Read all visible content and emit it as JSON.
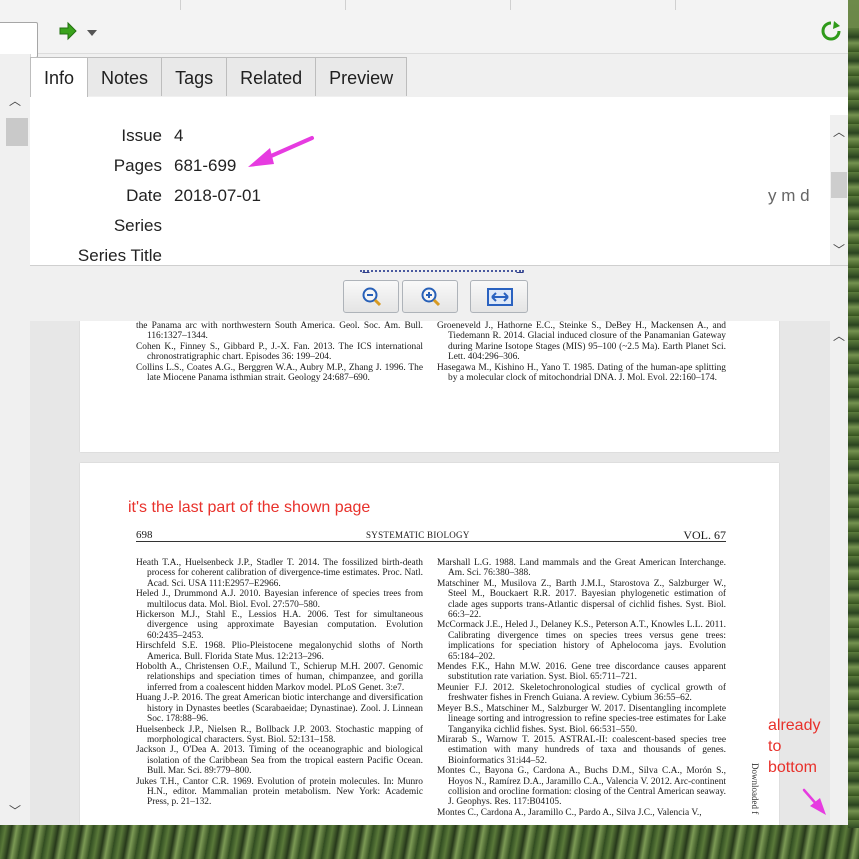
{
  "toolbar": {
    "forward_icon": "green-right-arrow-icon",
    "dropdown_icon": "chevron-down-icon",
    "sync_icon": "green-sync-icon"
  },
  "tabs": [
    "Info",
    "Notes",
    "Tags",
    "Related",
    "Preview"
  ],
  "info": {
    "fields": [
      {
        "label": "Issue",
        "value": "4"
      },
      {
        "label": "Pages",
        "value": "681-699"
      },
      {
        "label": "Date",
        "value": "2018-07-01"
      },
      {
        "label": "Series",
        "value": ""
      },
      {
        "label": "Series Title",
        "value": ""
      }
    ],
    "date_format": "y m d"
  },
  "pdf": {
    "page1": {
      "left_refs": [
        "the Panama arc with northwestern South America. Geol. Soc. Am. Bull. 116:1327–1344.",
        "Cohen K., Finney S., Gibbard P., J.-X. Fan. 2013. The ICS international chronostratigraphic chart. Episodes 36: 199–204.",
        "Collins L.S., Coates A.G., Berggren W.A., Aubry M.P., Zhang J. 1996. The late Miocene Panama isthmian strait. Geology 24:687–690."
      ],
      "right_refs": [
        "Groeneveld J., Hathorne E.C., Steinke S., DeBey H., Mackensen A., and Tiedemann R. 2014. Glacial induced closure of the Panamanian Gateway during Marine Isotope Stages (MIS) 95–100 (~2.5 Ma). Earth Planet Sci. Lett. 404:296–306.",
        "Hasegawa M., Kishino H., Yano T. 1985. Dating of the human-ape splitting by a molecular clock of mitochondrial DNA. J. Mol. Evol. 22:160–174."
      ]
    },
    "page2": {
      "page_number": "698",
      "journal": "SYSTEMATIC BIOLOGY",
      "volume": "VOL. 67",
      "side_text": "Downloaded f",
      "left_refs": [
        "Heath T.A., Huelsenbeck J.P., Stadler T. 2014. The fossilized birth-death process for coherent calibration of divergence-time estimates. Proc. Natl. Acad. Sci. USA 111:E2957–E2966.",
        "Heled J., Drummond A.J. 2010. Bayesian inference of species trees from multilocus data. Mol. Biol. Evol. 27:570–580.",
        "Hickerson M.J., Stahl E., Lessios H.A. 2006. Test for simultaneous divergence using approximate Bayesian computation. Evolution 60:2435–2453.",
        "Hirschfeld S.E. 1968. Plio-Pleistocene megalonychid sloths of North America. Bull. Florida State Mus. 12:213–296.",
        "Hobolth A., Christensen O.F., Mailund T., Schierup M.H. 2007. Genomic relationships and speciation times of human, chimpanzee, and gorilla inferred from a coalescent hidden Markov model. PLoS Genet. 3:e7.",
        "Huang J.-P. 2016. The great American biotic interchange and diversification history in Dynastes beetles (Scarabaeidae; Dynastinae). Zool. J. Linnean Soc. 178:88–96.",
        "Huelsenbeck J.P., Nielsen R., Bollback J.P. 2003. Stochastic mapping of morphological characters. Syst. Biol. 52:131–158.",
        "Jackson J., O'Dea A. 2013. Timing of the oceanographic and biological isolation of the Caribbean Sea from the tropical eastern Pacific Ocean. Bull. Mar. Sci. 89:779–800.",
        "Jukes T.H., Cantor C.R. 1969. Evolution of protein molecules. In: Munro H.N., editor. Mammalian protein metabolism. New York: Academic Press, p. 21–132."
      ],
      "right_refs": [
        "Marshall L.G. 1988. Land mammals and the Great American Interchange. Am. Sci. 76:380–388.",
        "Matschiner M., Musilova Z., Barth J.M.I., Starostova Z., Salzburger W., Steel M., Bouckaert R.R. 2017. Bayesian phylogenetic estimation of clade ages supports trans-Atlantic dispersal of cichlid fishes. Syst. Biol. 66:3–22.",
        "McCormack J.E., Heled J., Delaney K.S., Peterson A.T., Knowles L.L. 2011. Calibrating divergence times on species trees versus gene trees: implications for speciation history of Aphelocoma jays. Evolution 65:184–202.",
        "Mendes F.K., Hahn M.W. 2016. Gene tree discordance causes apparent substitution rate variation. Syst. Biol. 65:711–721.",
        "Meunier F.J. 2012. Skeletochronological studies of cyclical growth of freshwater fishes in French Guiana. A review. Cybium 36:55–62.",
        "Meyer B.S., Matschiner M., Salzburger W. 2017. Disentangling incomplete lineage sorting and introgression to refine species-tree estimates for Lake Tanganyika cichlid fishes. Syst. Biol. 66:531–550.",
        "Mirarab S., Warnow T. 2015. ASTRAL-II: coalescent-based species tree estimation with many hundreds of taxa and thousands of genes. Bioinformatics 31:i44–52.",
        "Montes C., Bayona G., Cardona A., Buchs D.M., Silva C.A., Morón S., Hoyos N., Ramírez D.A., Jaramillo C.A., Valencia V. 2012. Arc-continent collision and orocline formation: closing of the Central American seaway. J. Geophys. Res. 117:B04105.",
        "Montes C., Cardona A., Jaramillo C., Pardo A., Silva J.C., Valencia V.,"
      ]
    }
  },
  "annotations": {
    "last_part": "it's the last part of the shown page",
    "bottom": "already to bottom",
    "color": "#e8312b",
    "arrow_color": "#e63be0"
  }
}
